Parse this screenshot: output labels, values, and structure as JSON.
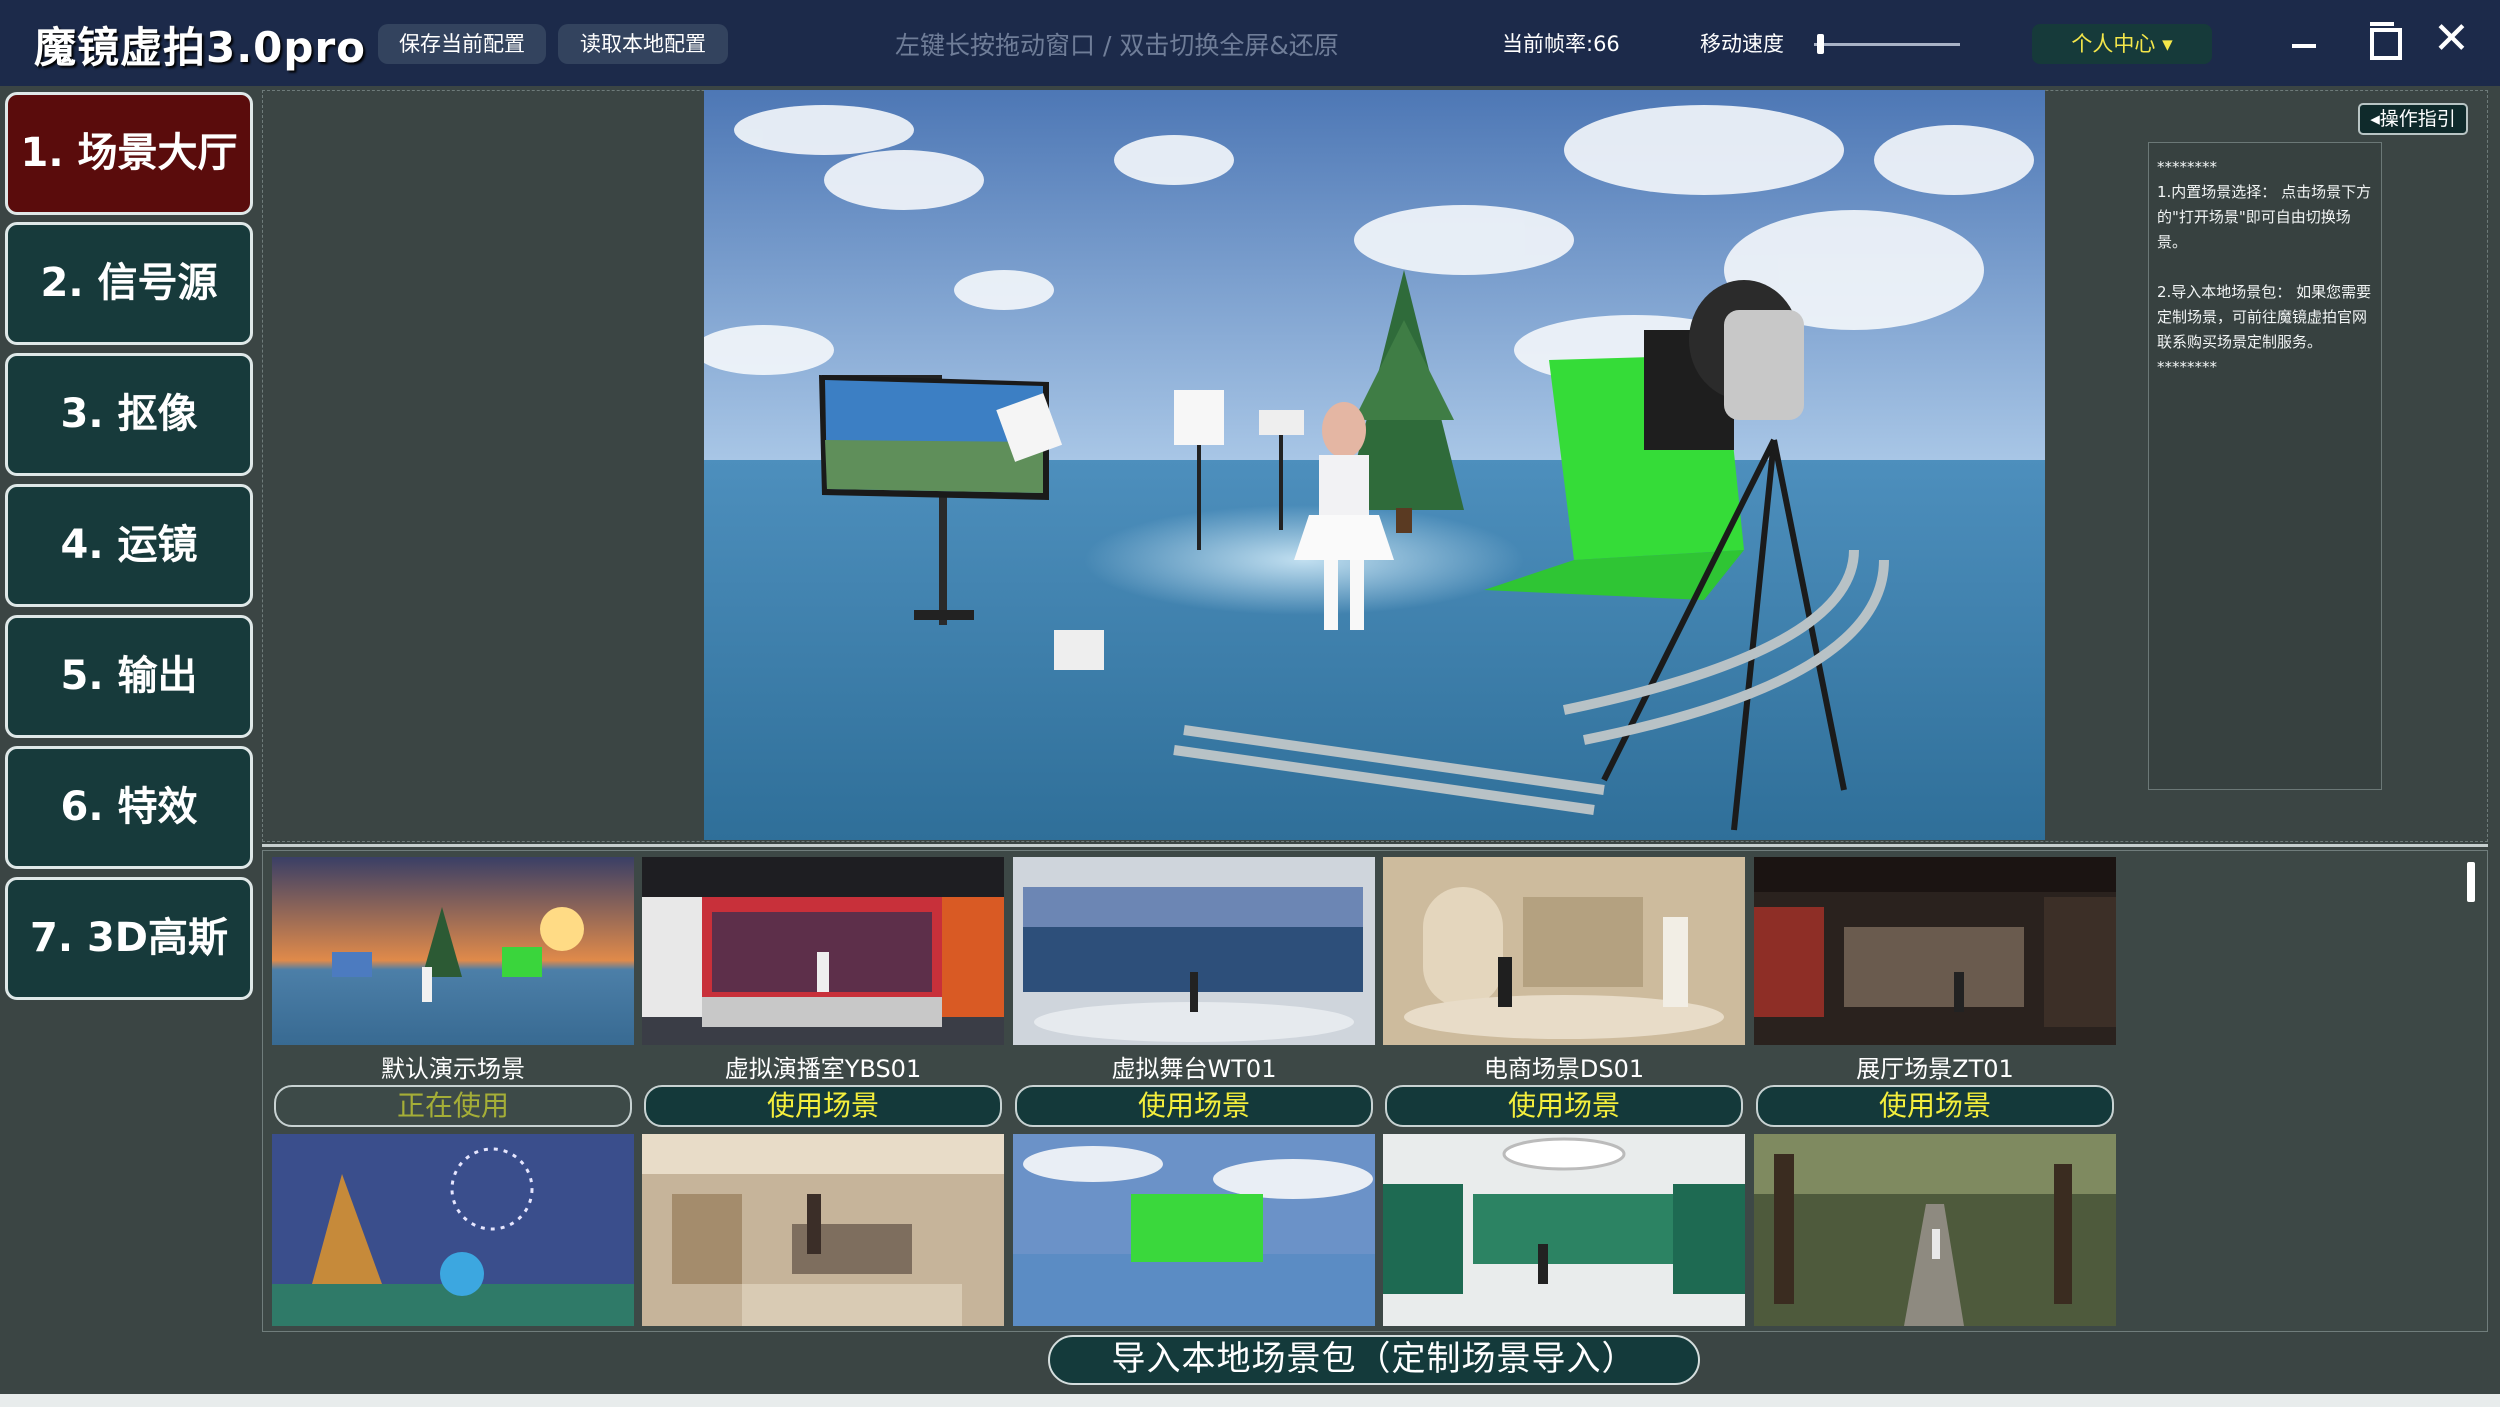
{
  "titlebar": {
    "app_title": "魔镜虚拍3.0pro",
    "save_config": "保存当前配置",
    "load_config": "读取本地配置",
    "hint": "左键长按拖动窗口 / 双击切换全屏&还原",
    "fps": "当前帧率:66",
    "speed_label": "移动速度",
    "speed_level": 0.02,
    "user_center": "个人中心 ▾"
  },
  "sidebar": {
    "items": [
      {
        "label": "1. 场景大厅",
        "active": true
      },
      {
        "label": "2. 信号源"
      },
      {
        "label": "3. 抠像"
      },
      {
        "label": "4. 运镜"
      },
      {
        "label": "5. 输出"
      },
      {
        "label": "6. 特效"
      },
      {
        "label": "7. 3D高斯"
      }
    ]
  },
  "guide": {
    "button": "◂操作指引",
    "text": "********\n1.内置场景选择： 点击场景下方的\"打开场景\"即可自由切换场景。\n\n2.导入本地场景包： 如果您需要定制场景，可前往魔镜虚拍官网联系购买场景定制服务。\n********"
  },
  "scenes": [
    {
      "name": "默认演示场景",
      "button": "正在使用"
    },
    {
      "name": "虚拟演播室YBS01",
      "button": "使用场景"
    },
    {
      "name": "虚拟舞台WT01",
      "button": "使用场景"
    },
    {
      "name": "电商场景DS01",
      "button": "使用场景"
    },
    {
      "name": "展厅场景ZT01",
      "button": "使用场景"
    }
  ],
  "import_button": "导入本地场景包（定制场景导入）"
}
